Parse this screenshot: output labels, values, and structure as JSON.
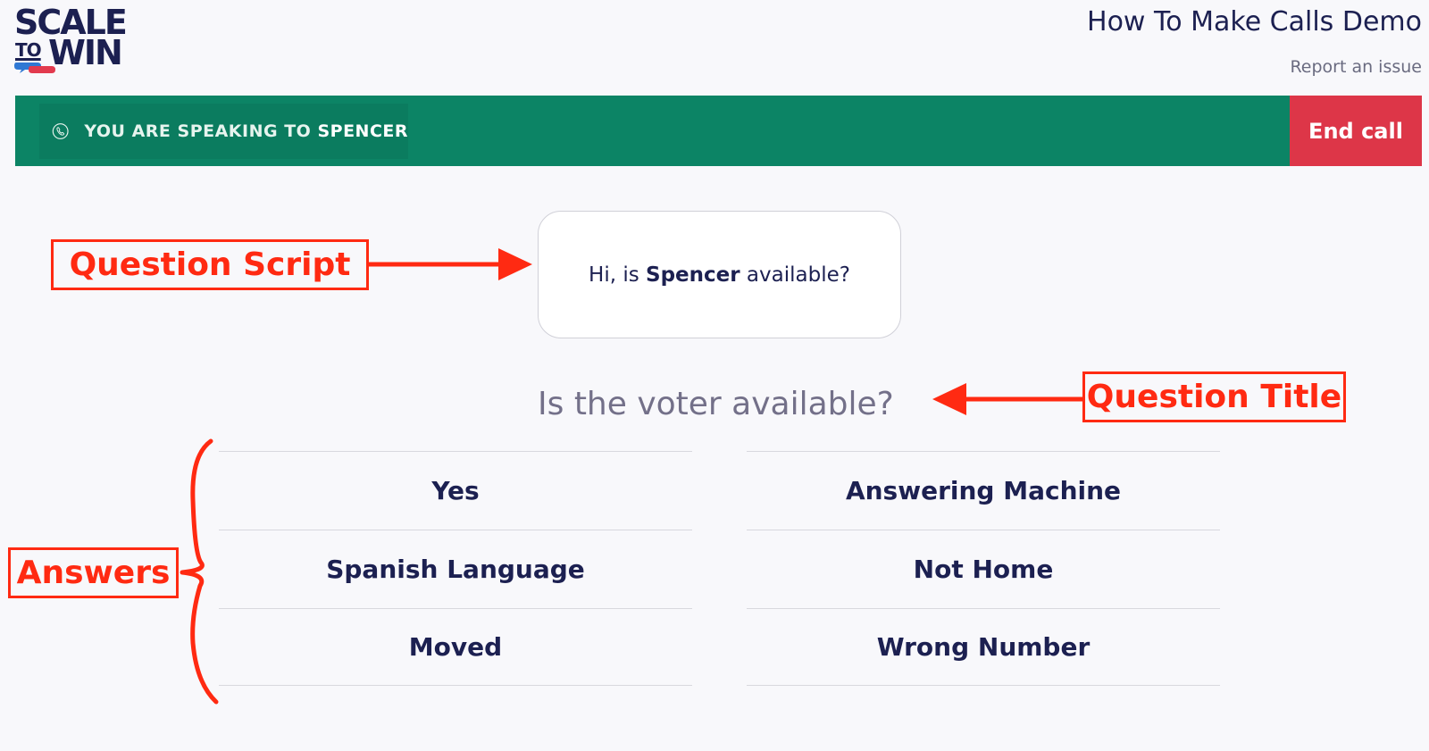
{
  "logo": {
    "line1": "SCALE",
    "line2a": "TO",
    "line2b": "WIN"
  },
  "header": {
    "title": "How To Make Calls Demo",
    "report_link": "Report an issue"
  },
  "call_bar": {
    "speaking_prefix": "YOU ARE SPEAKING TO",
    "contact_name": "SPENCER",
    "end_call_label": "End call",
    "bar_color": "#0c8465",
    "end_call_color": "#dd3648"
  },
  "script": {
    "prefix": "Hi, is",
    "name": "Spencer",
    "suffix": "available?"
  },
  "question_title": "Is the voter available?",
  "answers": {
    "left": [
      "Yes",
      "Spanish Language",
      "Moved"
    ],
    "right": [
      "Answering Machine",
      "Not Home",
      "Wrong Number"
    ]
  },
  "annotations": {
    "question_script": "Question Script",
    "question_title": "Question Title",
    "answers": "Answers",
    "color": "#ff2a12"
  },
  "icons": {
    "phone": "phone-icon"
  }
}
